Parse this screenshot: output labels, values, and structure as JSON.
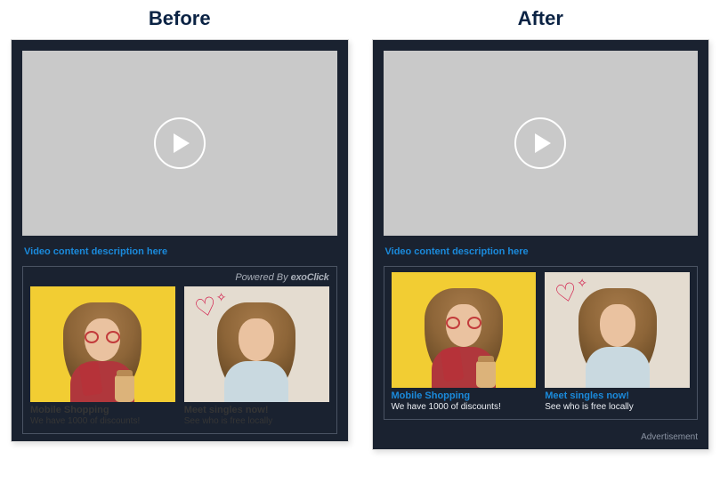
{
  "headers": {
    "before": "Before",
    "after": "After"
  },
  "video_desc": "Video content description here",
  "powered_by_prefix": "Powered By",
  "powered_by_brand": "exoClick",
  "advertisement_label": "Advertisement",
  "ads": [
    {
      "title": "Mobile Shopping",
      "sub": "We have 1000 of discounts!"
    },
    {
      "title": "Meet singles now!",
      "sub": "See who is free locally"
    }
  ]
}
